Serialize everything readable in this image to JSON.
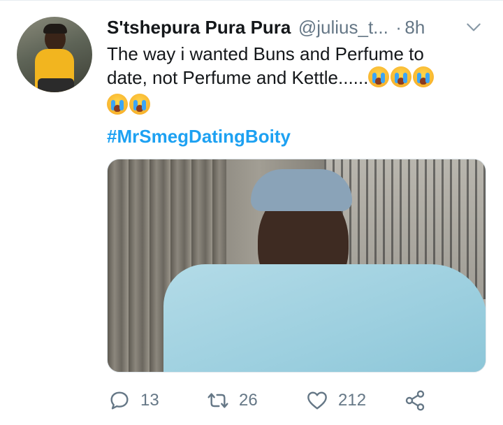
{
  "tweet": {
    "author_name": "S'tshepura Pura Pura",
    "author_handle": "@julius_t...",
    "separator": "·",
    "time": "8h",
    "text_line1": "The way i wanted Buns and Perfume to",
    "text_line2": "date, not Perfume and Kettle......",
    "hashtag": "#MrSmegDatingBoity",
    "emoji": "loudly-crying-face-emoji",
    "emoji_count": 5
  },
  "actions": {
    "replies": "13",
    "retweets": "26",
    "likes": "212"
  },
  "icons": {
    "reply": "reply-icon",
    "retweet": "retweet-icon",
    "like": "heart-icon",
    "share": "share-icon",
    "menu": "chevron-down-icon"
  },
  "colors": {
    "text": "#14171a",
    "secondary": "#657786",
    "link": "#1da1f2",
    "divider": "#e6ecf0"
  }
}
